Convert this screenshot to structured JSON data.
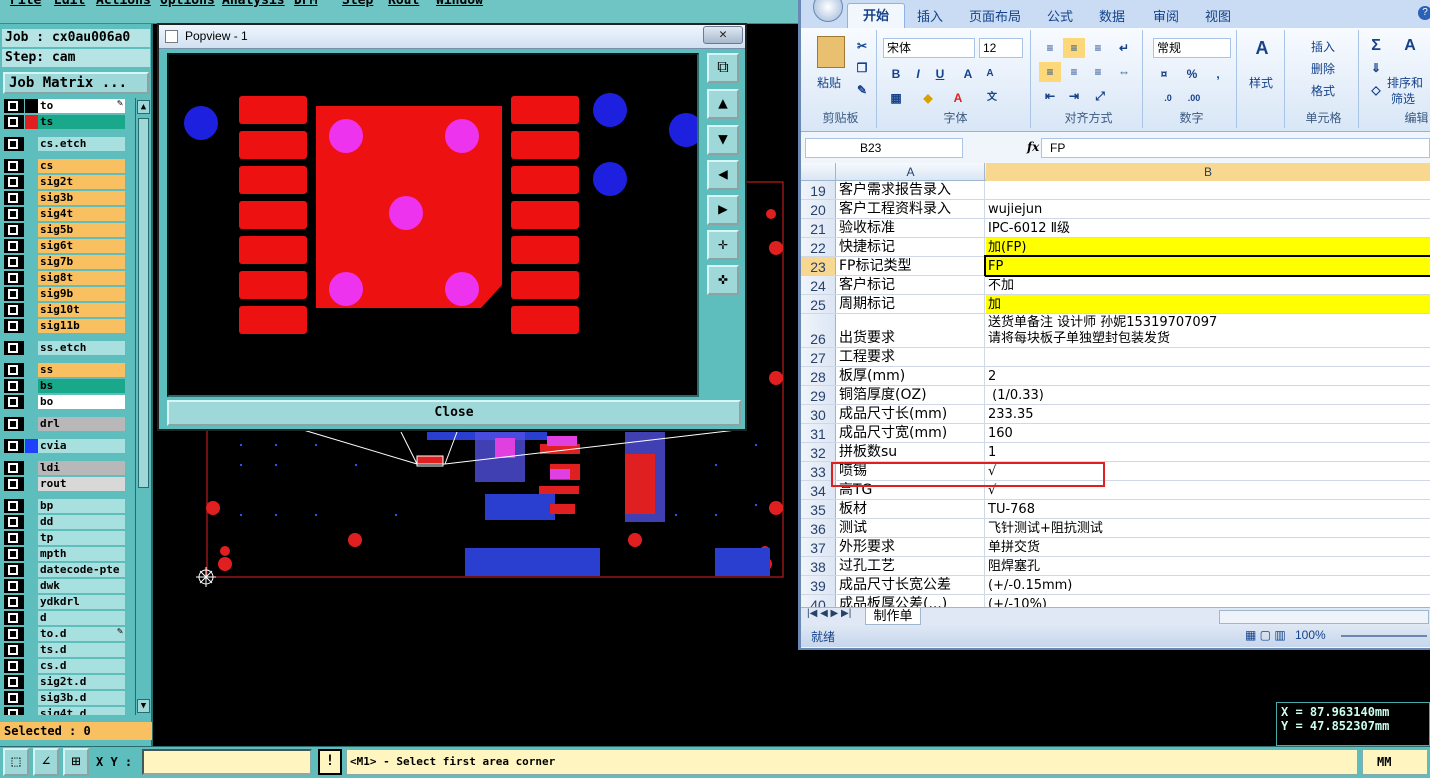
{
  "menu": {
    "items": [
      "File",
      "Edit",
      "Actions",
      "Options",
      "Analysis",
      "DFM",
      "Step",
      "Rout",
      "Window"
    ]
  },
  "job": {
    "job_line": "Job : cx0au006a0",
    "step_line": "Step: cam",
    "matrix_button": "Job Matrix ..."
  },
  "layers": [
    {
      "name": "to",
      "color": "#ffffff",
      "swatch": "#000000",
      "mark": "pencil"
    },
    {
      "name": "ts",
      "color": "#1aa88a",
      "swatch": "#e02020",
      "active": true
    },
    {
      "name": "cs.etch",
      "color": "#a8e0e0"
    },
    {
      "name": "cs",
      "color": "#f8c060"
    },
    {
      "name": "sig2t",
      "color": "#f8c060"
    },
    {
      "name": "sig3b",
      "color": "#f8c060"
    },
    {
      "name": "sig4t",
      "color": "#f8c060"
    },
    {
      "name": "sig5b",
      "color": "#f8c060"
    },
    {
      "name": "sig6t",
      "color": "#f8c060"
    },
    {
      "name": "sig7b",
      "color": "#f8c060"
    },
    {
      "name": "sig8t",
      "color": "#f8c060"
    },
    {
      "name": "sig9b",
      "color": "#f8c060"
    },
    {
      "name": "sig10t",
      "color": "#f8c060"
    },
    {
      "name": "sig11b",
      "color": "#f8c060"
    },
    {
      "name": "ss.etch",
      "color": "#a8e0e0"
    },
    {
      "name": "ss",
      "color": "#f8c060"
    },
    {
      "name": "bs",
      "color": "#1aa88a"
    },
    {
      "name": "bo",
      "color": "#ffffff"
    },
    {
      "name": "drl",
      "color": "#b8b8b8"
    },
    {
      "name": "cvia",
      "color": "#a8e0e0",
      "swatch": "#2040ff"
    },
    {
      "name": "ldi",
      "color": "#b8b8b8"
    },
    {
      "name": "rout",
      "color": "#d8d8d8"
    },
    {
      "name": "bp",
      "color": "#a8e0e0"
    },
    {
      "name": "dd",
      "color": "#a8e0e0"
    },
    {
      "name": "tp",
      "color": "#a8e0e0"
    },
    {
      "name": "mpth",
      "color": "#a8e0e0"
    },
    {
      "name": "datecode-pte",
      "color": "#a8e0e0"
    },
    {
      "name": "dwk",
      "color": "#a8e0e0"
    },
    {
      "name": "ydkdrl",
      "color": "#a8e0e0"
    },
    {
      "name": "d",
      "color": "#a8e0e0"
    },
    {
      "name": "to.d",
      "color": "#a8e0e0",
      "mark": "pencil"
    },
    {
      "name": "ts.d",
      "color": "#a8e0e0"
    },
    {
      "name": "cs.d",
      "color": "#a8e0e0"
    },
    {
      "name": "sig2t.d",
      "color": "#a8e0e0"
    },
    {
      "name": "sig3b.d",
      "color": "#a8e0e0"
    },
    {
      "name": "sig4t.d",
      "color": "#a8e0e0"
    }
  ],
  "selected_label": "Selected : 0",
  "popview": {
    "title": "Popview - 1",
    "close_label": "Close",
    "close_x": "✕"
  },
  "status": {
    "xy_label": "X Y :",
    "xy_value": "",
    "warn": "!",
    "prompt": "<M1> - Select first area corner",
    "unit": "MM"
  },
  "coords": {
    "x": "X = 87.963140mm",
    "y": "Y = 47.852307mm"
  },
  "excel": {
    "tabs": [
      "开始",
      "插入",
      "页面布局",
      "公式",
      "数据",
      "审阅",
      "视图"
    ],
    "font_name": "宋体",
    "font_size": "12",
    "number_format": "常规",
    "labels": {
      "paste": "粘贴",
      "clipboard": "剪贴板",
      "font": "字体",
      "align": "对齐方式",
      "number": "数字",
      "styles": "样式",
      "cells": "单元格",
      "edit": "编辑",
      "insert": "插入",
      "delete": "删除",
      "format": "格式",
      "sort": "排序和",
      "filter": "筛选"
    },
    "name_box": "B23",
    "formula": "FP",
    "col_a": "A",
    "col_b": "B",
    "rows": [
      {
        "n": "19",
        "a": "客户需求报告录入",
        "b": ""
      },
      {
        "n": "20",
        "a": "客户工程资料录入",
        "b": "wujiejun"
      },
      {
        "n": "21",
        "a": "验收标准",
        "b": "IPC-6012 Ⅱ级"
      },
      {
        "n": "22",
        "a": "快捷标记",
        "b": "加(FP)",
        "hl": true
      },
      {
        "n": "23",
        "a": "FP标记类型",
        "b": "FP",
        "hl": true,
        "sel": true
      },
      {
        "n": "24",
        "a": "客户标记",
        "b": "不加"
      },
      {
        "n": "25",
        "a": "周期标记",
        "b": "加",
        "hl": true
      },
      {
        "n": "26",
        "a": "出货要求",
        "b": "送货单备注 设计师 孙妮15319707097\n请将每块板子单独塑封包装发货",
        "tall": true
      },
      {
        "n": "27",
        "a": "工程要求",
        "b": ""
      },
      {
        "n": "28",
        "a": "板厚(mm)",
        "b": "2"
      },
      {
        "n": "29",
        "a": "铜箔厚度(OZ)",
        "b": " (1/0.33)"
      },
      {
        "n": "30",
        "a": "成品尺寸长(mm)",
        "b": "233.35"
      },
      {
        "n": "31",
        "a": "成品尺寸宽(mm)",
        "b": "160"
      },
      {
        "n": "32",
        "a": "拼板数su",
        "b": "1"
      },
      {
        "n": "33",
        "a": "喷锡",
        "b": "√"
      },
      {
        "n": "34",
        "a": "高TG",
        "b": "√"
      },
      {
        "n": "35",
        "a": "板材",
        "b": "TU-768"
      },
      {
        "n": "36",
        "a": "测试",
        "b": "飞针测试+阻抗测试"
      },
      {
        "n": "37",
        "a": "外形要求",
        "b": "单拼交货"
      },
      {
        "n": "38",
        "a": "过孔工艺",
        "b": "阻焊塞孔"
      },
      {
        "n": "39",
        "a": "成品尺寸长宽公差",
        "b": "(+/-0.15mm)"
      },
      {
        "n": "40",
        "a": "成品板厚公差(...)",
        "b": "(+/-10%)"
      }
    ],
    "sheet_tab": "制作单",
    "status_ready": "就绪",
    "zoom": "100%"
  }
}
